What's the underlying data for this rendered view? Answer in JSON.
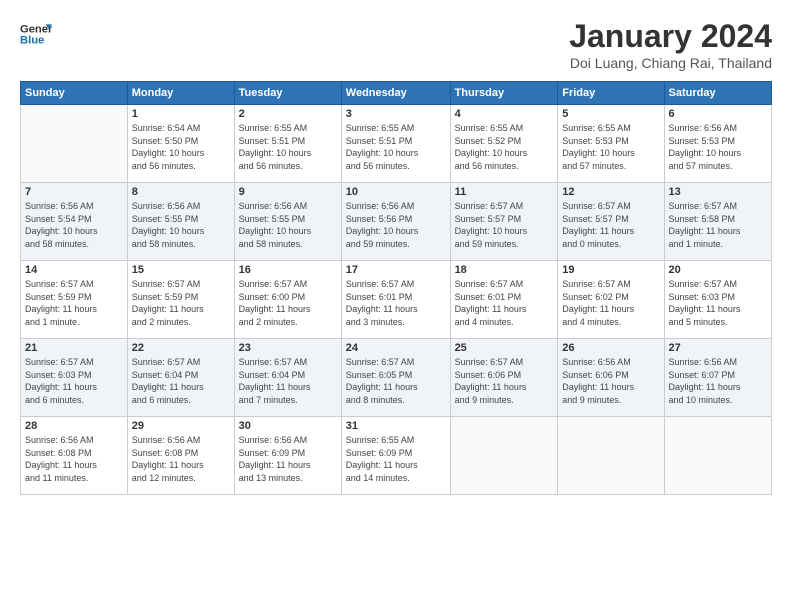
{
  "logo": {
    "line1": "General",
    "line2": "Blue"
  },
  "header": {
    "month": "January 2024",
    "location": "Doi Luang, Chiang Rai, Thailand"
  },
  "weekdays": [
    "Sunday",
    "Monday",
    "Tuesday",
    "Wednesday",
    "Thursday",
    "Friday",
    "Saturday"
  ],
  "weeks": [
    [
      {
        "day": "",
        "info": ""
      },
      {
        "day": "1",
        "info": "Sunrise: 6:54 AM\nSunset: 5:50 PM\nDaylight: 10 hours\nand 56 minutes."
      },
      {
        "day": "2",
        "info": "Sunrise: 6:55 AM\nSunset: 5:51 PM\nDaylight: 10 hours\nand 56 minutes."
      },
      {
        "day": "3",
        "info": "Sunrise: 6:55 AM\nSunset: 5:51 PM\nDaylight: 10 hours\nand 56 minutes."
      },
      {
        "day": "4",
        "info": "Sunrise: 6:55 AM\nSunset: 5:52 PM\nDaylight: 10 hours\nand 56 minutes."
      },
      {
        "day": "5",
        "info": "Sunrise: 6:55 AM\nSunset: 5:53 PM\nDaylight: 10 hours\nand 57 minutes."
      },
      {
        "day": "6",
        "info": "Sunrise: 6:56 AM\nSunset: 5:53 PM\nDaylight: 10 hours\nand 57 minutes."
      }
    ],
    [
      {
        "day": "7",
        "info": "Sunrise: 6:56 AM\nSunset: 5:54 PM\nDaylight: 10 hours\nand 58 minutes."
      },
      {
        "day": "8",
        "info": "Sunrise: 6:56 AM\nSunset: 5:55 PM\nDaylight: 10 hours\nand 58 minutes."
      },
      {
        "day": "9",
        "info": "Sunrise: 6:56 AM\nSunset: 5:55 PM\nDaylight: 10 hours\nand 58 minutes."
      },
      {
        "day": "10",
        "info": "Sunrise: 6:56 AM\nSunset: 5:56 PM\nDaylight: 10 hours\nand 59 minutes."
      },
      {
        "day": "11",
        "info": "Sunrise: 6:57 AM\nSunset: 5:57 PM\nDaylight: 10 hours\nand 59 minutes."
      },
      {
        "day": "12",
        "info": "Sunrise: 6:57 AM\nSunset: 5:57 PM\nDaylight: 11 hours\nand 0 minutes."
      },
      {
        "day": "13",
        "info": "Sunrise: 6:57 AM\nSunset: 5:58 PM\nDaylight: 11 hours\nand 1 minute."
      }
    ],
    [
      {
        "day": "14",
        "info": "Sunrise: 6:57 AM\nSunset: 5:59 PM\nDaylight: 11 hours\nand 1 minute."
      },
      {
        "day": "15",
        "info": "Sunrise: 6:57 AM\nSunset: 5:59 PM\nDaylight: 11 hours\nand 2 minutes."
      },
      {
        "day": "16",
        "info": "Sunrise: 6:57 AM\nSunset: 6:00 PM\nDaylight: 11 hours\nand 2 minutes."
      },
      {
        "day": "17",
        "info": "Sunrise: 6:57 AM\nSunset: 6:01 PM\nDaylight: 11 hours\nand 3 minutes."
      },
      {
        "day": "18",
        "info": "Sunrise: 6:57 AM\nSunset: 6:01 PM\nDaylight: 11 hours\nand 4 minutes."
      },
      {
        "day": "19",
        "info": "Sunrise: 6:57 AM\nSunset: 6:02 PM\nDaylight: 11 hours\nand 4 minutes."
      },
      {
        "day": "20",
        "info": "Sunrise: 6:57 AM\nSunset: 6:03 PM\nDaylight: 11 hours\nand 5 minutes."
      }
    ],
    [
      {
        "day": "21",
        "info": "Sunrise: 6:57 AM\nSunset: 6:03 PM\nDaylight: 11 hours\nand 6 minutes."
      },
      {
        "day": "22",
        "info": "Sunrise: 6:57 AM\nSunset: 6:04 PM\nDaylight: 11 hours\nand 6 minutes."
      },
      {
        "day": "23",
        "info": "Sunrise: 6:57 AM\nSunset: 6:04 PM\nDaylight: 11 hours\nand 7 minutes."
      },
      {
        "day": "24",
        "info": "Sunrise: 6:57 AM\nSunset: 6:05 PM\nDaylight: 11 hours\nand 8 minutes."
      },
      {
        "day": "25",
        "info": "Sunrise: 6:57 AM\nSunset: 6:06 PM\nDaylight: 11 hours\nand 9 minutes."
      },
      {
        "day": "26",
        "info": "Sunrise: 6:56 AM\nSunset: 6:06 PM\nDaylight: 11 hours\nand 9 minutes."
      },
      {
        "day": "27",
        "info": "Sunrise: 6:56 AM\nSunset: 6:07 PM\nDaylight: 11 hours\nand 10 minutes."
      }
    ],
    [
      {
        "day": "28",
        "info": "Sunrise: 6:56 AM\nSunset: 6:08 PM\nDaylight: 11 hours\nand 11 minutes."
      },
      {
        "day": "29",
        "info": "Sunrise: 6:56 AM\nSunset: 6:08 PM\nDaylight: 11 hours\nand 12 minutes."
      },
      {
        "day": "30",
        "info": "Sunrise: 6:56 AM\nSunset: 6:09 PM\nDaylight: 11 hours\nand 13 minutes."
      },
      {
        "day": "31",
        "info": "Sunrise: 6:55 AM\nSunset: 6:09 PM\nDaylight: 11 hours\nand 14 minutes."
      },
      {
        "day": "",
        "info": ""
      },
      {
        "day": "",
        "info": ""
      },
      {
        "day": "",
        "info": ""
      }
    ]
  ]
}
